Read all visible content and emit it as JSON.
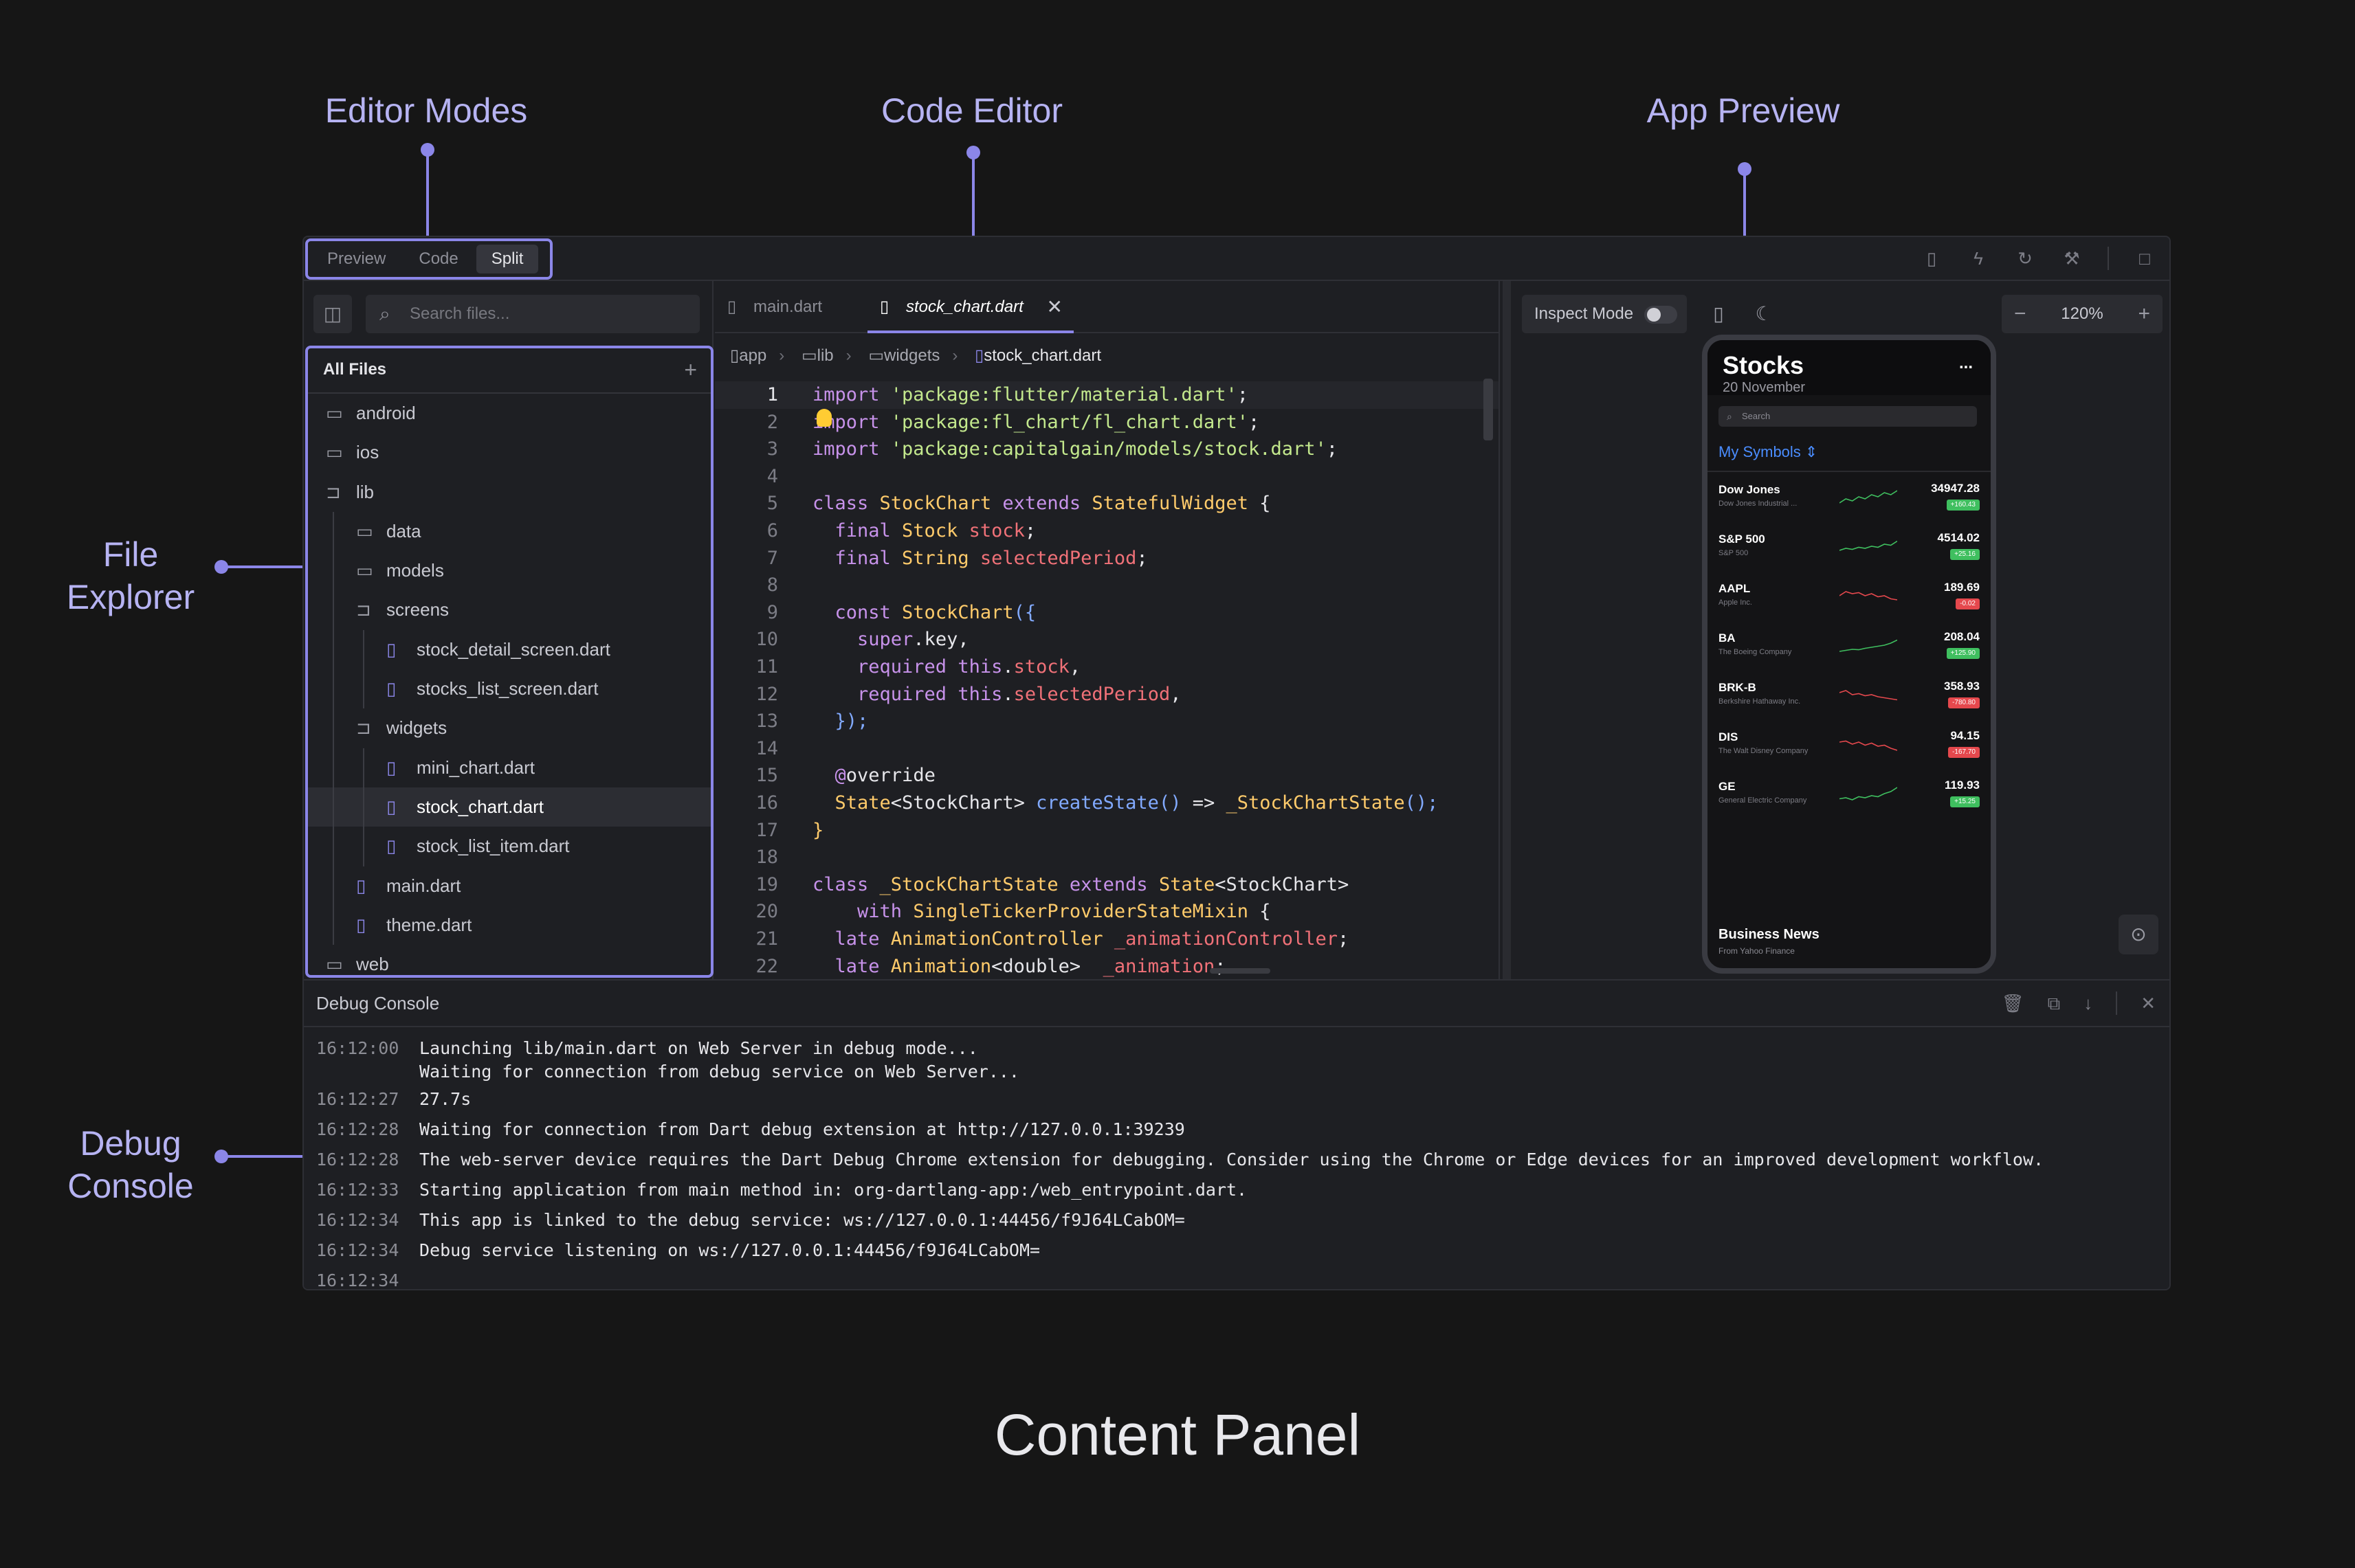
{
  "callouts": {
    "editor_modes": "Editor Modes",
    "code_editor": "Code Editor",
    "app_preview": "App Preview",
    "file_explorer": [
      "File",
      "Explorer"
    ],
    "debug_console": [
      "Debug",
      "Console"
    ],
    "content_panel": "Content Panel"
  },
  "modes": {
    "preview": "Preview",
    "code": "Code",
    "split": "Split",
    "active": "Split"
  },
  "toolbar_icons": [
    "layout-icon",
    "flash-icon",
    "refresh-icon",
    "wrench-icon",
    "maximize-icon"
  ],
  "search": {
    "placeholder": "Search files..."
  },
  "explorer": {
    "header": "All Files",
    "items": [
      {
        "label": "android",
        "type": "folder",
        "depth": 0
      },
      {
        "label": "ios",
        "type": "folder",
        "depth": 0
      },
      {
        "label": "lib",
        "type": "folder-open",
        "depth": 0
      },
      {
        "label": "data",
        "type": "folder",
        "depth": 1
      },
      {
        "label": "models",
        "type": "folder",
        "depth": 1
      },
      {
        "label": "screens",
        "type": "folder-open",
        "depth": 1
      },
      {
        "label": "stock_detail_screen.dart",
        "type": "file",
        "depth": 2
      },
      {
        "label": "stocks_list_screen.dart",
        "type": "file",
        "depth": 2
      },
      {
        "label": "widgets",
        "type": "folder-open",
        "depth": 1
      },
      {
        "label": "mini_chart.dart",
        "type": "file",
        "depth": 2
      },
      {
        "label": "stock_chart.dart",
        "type": "file",
        "depth": 2,
        "selected": true
      },
      {
        "label": "stock_list_item.dart",
        "type": "file",
        "depth": 2
      },
      {
        "label": "main.dart",
        "type": "file",
        "depth": 1
      },
      {
        "label": "theme.dart",
        "type": "file",
        "depth": 1
      },
      {
        "label": "web",
        "type": "folder",
        "depth": 0
      }
    ]
  },
  "tabs": [
    {
      "label": "main.dart",
      "active": false
    },
    {
      "label": "stock_chart.dart",
      "active": true
    }
  ],
  "breadcrumb": [
    "app",
    "lib",
    "widgets",
    "stock_chart.dart"
  ],
  "code": {
    "current_line": 1,
    "lines": [
      [
        [
          "import ",
          "kw"
        ],
        [
          "'package:flutter/material.dart'",
          "str"
        ],
        [
          ";",
          "pn"
        ]
      ],
      [
        [
          "import ",
          "kw"
        ],
        [
          "'package:fl_chart/fl_chart.dart'",
          "str"
        ],
        [
          ";",
          "pn"
        ]
      ],
      [
        [
          "import ",
          "kw"
        ],
        [
          "'package:capitalgain/models/stock.dart'",
          "str"
        ],
        [
          ";",
          "pn"
        ]
      ],
      [],
      [
        [
          "class ",
          "kw"
        ],
        [
          "StockChart ",
          "ty"
        ],
        [
          "extends ",
          "kw"
        ],
        [
          "StatefulWidget ",
          "ty"
        ],
        [
          "{",
          "pn"
        ]
      ],
      [
        [
          "  final ",
          "kw"
        ],
        [
          "Stock ",
          "ty"
        ],
        [
          "stock",
          "va"
        ],
        [
          ";",
          "pn"
        ]
      ],
      [
        [
          "  final ",
          "kw"
        ],
        [
          "String ",
          "ty"
        ],
        [
          "selectedPeriod",
          "va"
        ],
        [
          ";",
          "pn"
        ]
      ],
      [],
      [
        [
          "  const ",
          "kw"
        ],
        [
          "StockChart",
          "ty"
        ],
        [
          "({",
          "fn"
        ]
      ],
      [
        [
          "    super",
          "kw"
        ],
        [
          ".key,",
          "pn"
        ]
      ],
      [
        [
          "    required ",
          "kw"
        ],
        [
          "this",
          "kw"
        ],
        [
          ".",
          "pn"
        ],
        [
          "stock",
          "va"
        ],
        [
          ",",
          "pn"
        ]
      ],
      [
        [
          "    required ",
          "kw"
        ],
        [
          "this",
          "kw"
        ],
        [
          ".",
          "pn"
        ],
        [
          "selectedPeriod",
          "va"
        ],
        [
          ",",
          "pn"
        ]
      ],
      [
        [
          "  });",
          "fn"
        ]
      ],
      [],
      [
        [
          "  @",
          "at"
        ],
        [
          "override",
          "pn"
        ]
      ],
      [
        [
          "  State",
          "ty"
        ],
        [
          "<StockChart> ",
          "pn"
        ],
        [
          "createState",
          "fn"
        ],
        [
          "() ",
          "fn"
        ],
        [
          "=> ",
          "pn"
        ],
        [
          "_StockChartState",
          "ty"
        ],
        [
          "();",
          "fn"
        ]
      ],
      [
        [
          "}",
          "ty"
        ]
      ],
      [],
      [
        [
          "class ",
          "kw"
        ],
        [
          "_StockChartState ",
          "ty"
        ],
        [
          "extends ",
          "kw"
        ],
        [
          "State",
          "ty"
        ],
        [
          "<StockChart>",
          "pn"
        ]
      ],
      [
        [
          "    with ",
          "kw"
        ],
        [
          "SingleTickerProviderStateMixin ",
          "ty"
        ],
        [
          "{",
          "pn"
        ]
      ],
      [
        [
          "  late ",
          "kw"
        ],
        [
          "AnimationController ",
          "ty"
        ],
        [
          "_animationController",
          "va"
        ],
        [
          ";",
          "pn"
        ]
      ],
      [
        [
          "  late ",
          "kw"
        ],
        [
          "Animation",
          "ty"
        ],
        [
          "<double>  ",
          "pn"
        ],
        [
          "_animation",
          "va"
        ],
        [
          ";",
          "pn"
        ]
      ]
    ]
  },
  "preview": {
    "inspect_label": "Inspect Mode",
    "zoom": "120%",
    "phone": {
      "title": "Stocks",
      "date": "20 November",
      "more": "...",
      "search": "Search",
      "symbols_label": "My Symbols",
      "stocks": [
        {
          "symbol": "Dow Jones",
          "name": "Dow Jones Industrial ...",
          "price": "34947.28",
          "change": "+160.43",
          "up": true,
          "trend": [
            0.3,
            0.5,
            0.4,
            0.6,
            0.5,
            0.7,
            0.6,
            0.8,
            0.7,
            0.9
          ]
        },
        {
          "symbol": "S&P 500",
          "name": "S&P 500",
          "price": "4514.02",
          "change": "+25.16",
          "up": true,
          "trend": [
            0.4,
            0.5,
            0.45,
            0.55,
            0.5,
            0.6,
            0.55,
            0.7,
            0.65,
            0.85
          ]
        },
        {
          "symbol": "AAPL",
          "name": "Apple Inc.",
          "price": "189.69",
          "change": "-0.02",
          "up": false,
          "trend": [
            0.6,
            0.8,
            0.7,
            0.75,
            0.6,
            0.7,
            0.55,
            0.6,
            0.45,
            0.4
          ]
        },
        {
          "symbol": "BA",
          "name": "The Boeing Company",
          "price": "208.04",
          "change": "+125.90",
          "up": true,
          "trend": [
            0.3,
            0.35,
            0.4,
            0.38,
            0.45,
            0.5,
            0.55,
            0.6,
            0.7,
            0.85
          ]
        },
        {
          "symbol": "BRK-B",
          "name": "Berkshire Hathaway Inc.",
          "price": "358.93",
          "change": "-780.80",
          "up": false,
          "trend": [
            0.7,
            0.8,
            0.6,
            0.65,
            0.55,
            0.6,
            0.5,
            0.45,
            0.4,
            0.35
          ]
        },
        {
          "symbol": "DIS",
          "name": "The Walt Disney Company",
          "price": "94.15",
          "change": "-167.70",
          "up": false,
          "trend": [
            0.7,
            0.75,
            0.6,
            0.7,
            0.55,
            0.65,
            0.5,
            0.55,
            0.4,
            0.3
          ]
        },
        {
          "symbol": "GE",
          "name": "General Electric Company",
          "price": "119.93",
          "change": "+15.25",
          "up": true,
          "trend": [
            0.35,
            0.4,
            0.3,
            0.45,
            0.4,
            0.5,
            0.45,
            0.6,
            0.7,
            0.9
          ]
        }
      ],
      "news_title": "Business News",
      "news_sub": "From Yahoo Finance"
    }
  },
  "debug": {
    "title": "Debug Console",
    "icons": [
      "trash-icon",
      "copy-icon",
      "download-icon",
      "close-icon"
    ],
    "lines": [
      {
        "ts": "16:12:00",
        "text": "Launching lib/main.dart on Web Server in debug mode..."
      },
      {
        "ts": "",
        "text": "Waiting for connection from debug service on Web Server..."
      },
      {
        "ts": "16:12:27",
        "text": "27.7s"
      },
      {
        "ts": "16:12:28",
        "text": "Waiting for connection from Dart debug extension at http://127.0.0.1:39239"
      },
      {
        "ts": "16:12:28",
        "text": "The web-server device requires the Dart Debug Chrome extension for debugging. Consider using the Chrome or Edge devices for an improved development workflow."
      },
      {
        "ts": "16:12:33",
        "text": "Starting application from main method in: org-dartlang-app:/web_entrypoint.dart."
      },
      {
        "ts": "16:12:34",
        "text": "This app is linked to the debug service: ws://127.0.0.1:44456/f9J64LCabOM="
      },
      {
        "ts": "16:12:34",
        "text": "Debug service listening on ws://127.0.0.1:44456/f9J64LCabOM="
      },
      {
        "ts": "16:12:34",
        "text": ""
      }
    ]
  },
  "colors": {
    "accent": "#8b86e8",
    "up": "#3fbf5f",
    "down": "#e5484d"
  }
}
